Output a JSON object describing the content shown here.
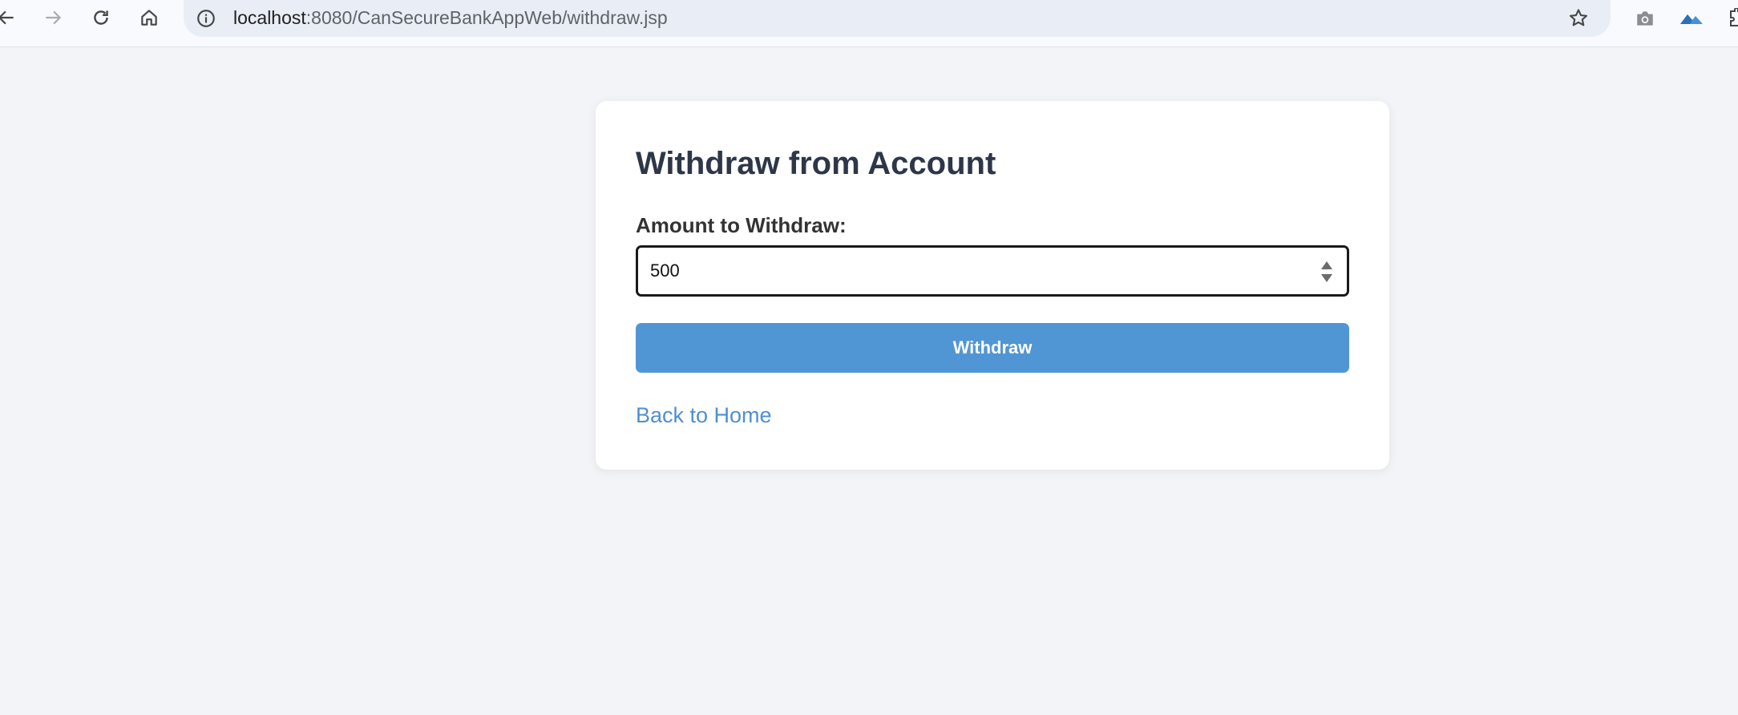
{
  "browser": {
    "url_host": "localhost",
    "url_path": ":8080/CanSecureBankAppWeb/withdraw.jsp"
  },
  "form": {
    "title": "Withdraw from Account",
    "amount_label": "Amount to Withdraw:",
    "amount_value": "500",
    "submit_label": "Withdraw",
    "back_link": "Back to Home"
  },
  "colors": {
    "page_background": "#f2f4f7",
    "card_background": "#ffffff",
    "heading": "#2d3748",
    "button": "#5196d4",
    "link": "#4f8fd0"
  }
}
